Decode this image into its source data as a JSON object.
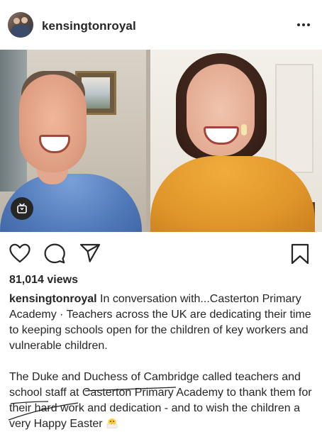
{
  "header": {
    "username": "kensingtonroyal",
    "more_icon": "more-horizontal-icon"
  },
  "media": {
    "badge_icon": "igtv-icon"
  },
  "actions": {
    "like_icon": "heart-icon",
    "comment_icon": "comment-icon",
    "share_icon": "send-icon",
    "save_icon": "bookmark-icon"
  },
  "stats": {
    "views": "81,014 views"
  },
  "caption": {
    "username": "kensingtonroyal",
    "paragraph1": " In conversation with...Casterton Primary Academy · Teachers across the UK are dedicating their time to keeping schools open for the children of key workers and vulnerable children.",
    "paragraph2": "The Duke and Duchess of Cambridge called teachers and school staff at Casterton Primary Academy to thank them for their hard work and dedication - and to wish the children a very Happy Easter",
    "emoji": "hatching-chick-emoji"
  },
  "colors": {
    "text": "#262626",
    "background": "#ffffff"
  }
}
